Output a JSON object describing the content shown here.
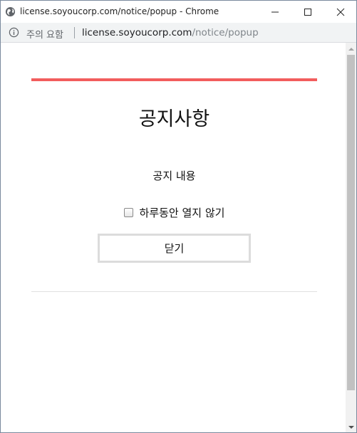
{
  "window": {
    "title": "license.soyoucorp.com/notice/popup - Chrome"
  },
  "address_bar": {
    "security_label": "주의 요함",
    "url_host": "license.soyoucorp.com",
    "url_path": "/notice/popup"
  },
  "notice": {
    "title": "공지사항",
    "body": "공지 내용",
    "checkbox_label": "하루동안 열지 않기",
    "checkbox_checked": false,
    "close_button_label": "닫기"
  },
  "icons": {
    "title_icon": "globe-icon",
    "info_icon": "info-icon",
    "minimize": "minimize-icon",
    "maximize": "maximize-icon",
    "close": "close-icon",
    "scroll_up": "scroll-up-arrow-icon",
    "scroll_down": "scroll-down-arrow-icon"
  },
  "colors": {
    "accent_bar": "#f25d5d",
    "address_bar_bg": "#f1f3f4",
    "url_path": "#80868b"
  }
}
